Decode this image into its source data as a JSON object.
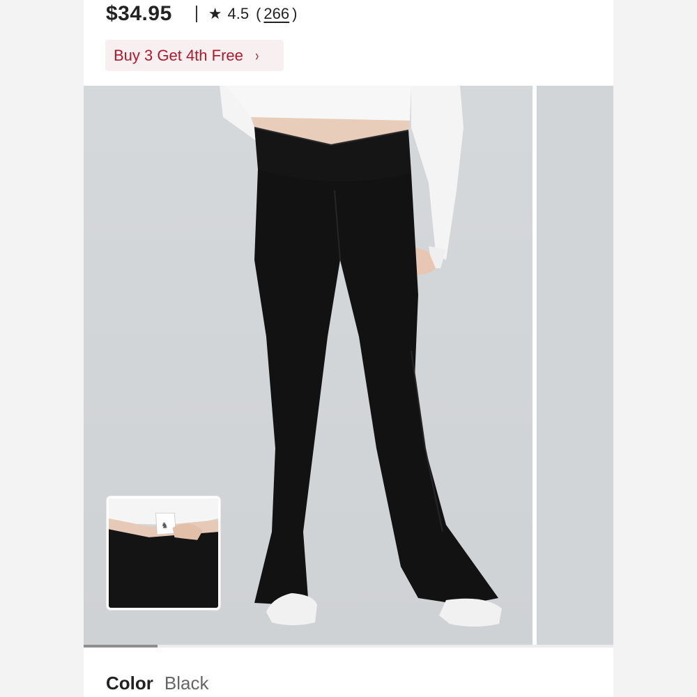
{
  "product": {
    "price": "$34.95",
    "rating": "4.5",
    "review_count": "266",
    "rating_icon": "star-icon"
  },
  "promo": {
    "label": "Buy 3 Get 4th Free",
    "chevron": "›",
    "text_color": "#b0182a",
    "background": "#f8f0f0"
  },
  "gallery": {
    "progress_fraction": 0.14,
    "main_image": "black flare leggings with crossover waistband, white crop top, white sneakers",
    "thumbnail_image": "waistband pocket detail with card"
  },
  "color": {
    "label": "Color",
    "value": "Black"
  }
}
